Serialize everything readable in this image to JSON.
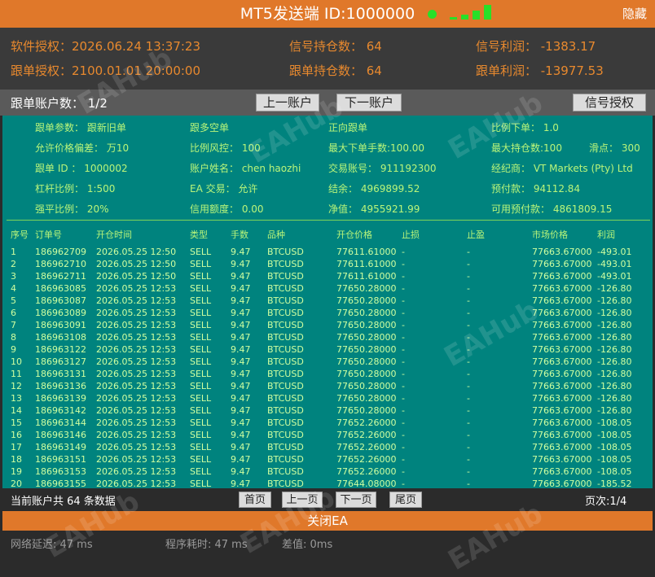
{
  "title": "MT5发送端  ID:1000000",
  "hide_label": "隐藏",
  "colors": {
    "accent": "#e0782a",
    "panel": "#00837e",
    "text_green": "#b9f57a",
    "status_led": "#28e028"
  },
  "info": {
    "software_auth": "软件授权：2026.06.24 13:37:23",
    "signal_positions": "信号持仓数：  64",
    "signal_profit": "信号利润：  -1383.17",
    "follow_auth": "跟单授权：2100.01.01 20:00:00",
    "follow_positions": "跟单持仓数：  64",
    "follow_profit": "跟单利润：  -13977.53"
  },
  "nav": {
    "account_count": "跟单账户数：  1/2",
    "prev": "上一账户",
    "next": "下一账户",
    "signal_auth": "信号授权"
  },
  "params": {
    "p1": "跟单参数：  跟新旧单",
    "p2": "跟多空单",
    "p3": "正向跟单",
    "p4": "比例下单：  1.0",
    "p5": "允许价格偏差：  万10",
    "p6": "比例风控：  100",
    "p7": "最大下单手数:100.00",
    "p8": "最大持仓数:100",
    "p9": "滑点：  300",
    "p10": "跟单   ID  ：  1000002",
    "p11": "账户姓名：  chen haozhi",
    "p12": "交易账号：  911192300",
    "p13": "经纪商：  VT Markets (Pty) Ltd",
    "p14": "杠杆比例：  1:500",
    "p15": "EA  交易：  允许",
    "p16": "结余：  4969899.52",
    "p17": "预付款：  94112.84",
    "p18": "强平比例：  20%",
    "p19": "信用额度：  0.00",
    "p20": "净值：  4955921.99",
    "p21": "可用预付款：  4861809.15"
  },
  "table": {
    "headers": [
      "序号",
      "订单号",
      "开仓时间",
      "类型",
      "手数",
      "品种",
      "开仓价格",
      "止损",
      "止盈",
      "市场价格",
      "利润"
    ],
    "rows": [
      [
        "1",
        "186962709",
        "2026.05.25 12:50",
        "SELL",
        "9.47",
        "BTCUSD",
        "77611.61000",
        "-",
        "-",
        "77663.67000",
        "-493.01"
      ],
      [
        "2",
        "186962710",
        "2026.05.25 12:50",
        "SELL",
        "9.47",
        "BTCUSD",
        "77611.61000",
        "-",
        "-",
        "77663.67000",
        "-493.01"
      ],
      [
        "3",
        "186962711",
        "2026.05.25 12:50",
        "SELL",
        "9.47",
        "BTCUSD",
        "77611.61000",
        "-",
        "-",
        "77663.67000",
        "-493.01"
      ],
      [
        "4",
        "186963085",
        "2026.05.25 12:53",
        "SELL",
        "9.47",
        "BTCUSD",
        "77650.28000",
        "-",
        "-",
        "77663.67000",
        "-126.80"
      ],
      [
        "5",
        "186963087",
        "2026.05.25 12:53",
        "SELL",
        "9.47",
        "BTCUSD",
        "77650.28000",
        "-",
        "-",
        "77663.67000",
        "-126.80"
      ],
      [
        "6",
        "186963089",
        "2026.05.25 12:53",
        "SELL",
        "9.47",
        "BTCUSD",
        "77650.28000",
        "-",
        "-",
        "77663.67000",
        "-126.80"
      ],
      [
        "7",
        "186963091",
        "2026.05.25 12:53",
        "SELL",
        "9.47",
        "BTCUSD",
        "77650.28000",
        "-",
        "-",
        "77663.67000",
        "-126.80"
      ],
      [
        "8",
        "186963108",
        "2026.05.25 12:53",
        "SELL",
        "9.47",
        "BTCUSD",
        "77650.28000",
        "-",
        "-",
        "77663.67000",
        "-126.80"
      ],
      [
        "9",
        "186963122",
        "2026.05.25 12:53",
        "SELL",
        "9.47",
        "BTCUSD",
        "77650.28000",
        "-",
        "-",
        "77663.67000",
        "-126.80"
      ],
      [
        "10",
        "186963127",
        "2026.05.25 12:53",
        "SELL",
        "9.47",
        "BTCUSD",
        "77650.28000",
        "-",
        "-",
        "77663.67000",
        "-126.80"
      ],
      [
        "11",
        "186963131",
        "2026.05.25 12:53",
        "SELL",
        "9.47",
        "BTCUSD",
        "77650.28000",
        "-",
        "-",
        "77663.67000",
        "-126.80"
      ],
      [
        "12",
        "186963136",
        "2026.05.25 12:53",
        "SELL",
        "9.47",
        "BTCUSD",
        "77650.28000",
        "-",
        "-",
        "77663.67000",
        "-126.80"
      ],
      [
        "13",
        "186963139",
        "2026.05.25 12:53",
        "SELL",
        "9.47",
        "BTCUSD",
        "77650.28000",
        "-",
        "-",
        "77663.67000",
        "-126.80"
      ],
      [
        "14",
        "186963142",
        "2026.05.25 12:53",
        "SELL",
        "9.47",
        "BTCUSD",
        "77650.28000",
        "-",
        "-",
        "77663.67000",
        "-126.80"
      ],
      [
        "15",
        "186963144",
        "2026.05.25 12:53",
        "SELL",
        "9.47",
        "BTCUSD",
        "77652.26000",
        "-",
        "-",
        "77663.67000",
        "-108.05"
      ],
      [
        "16",
        "186963146",
        "2026.05.25 12:53",
        "SELL",
        "9.47",
        "BTCUSD",
        "77652.26000",
        "-",
        "-",
        "77663.67000",
        "-108.05"
      ],
      [
        "17",
        "186963149",
        "2026.05.25 12:53",
        "SELL",
        "9.47",
        "BTCUSD",
        "77652.26000",
        "-",
        "-",
        "77663.67000",
        "-108.05"
      ],
      [
        "18",
        "186963151",
        "2026.05.25 12:53",
        "SELL",
        "9.47",
        "BTCUSD",
        "77652.26000",
        "-",
        "-",
        "77663.67000",
        "-108.05"
      ],
      [
        "19",
        "186963153",
        "2026.05.25 12:53",
        "SELL",
        "9.47",
        "BTCUSD",
        "77652.26000",
        "-",
        "-",
        "77663.67000",
        "-108.05"
      ],
      [
        "20",
        "186963155",
        "2026.05.25 12:53",
        "SELL",
        "9.47",
        "BTCUSD",
        "77644.08000",
        "-",
        "-",
        "77663.67000",
        "-185.52"
      ]
    ]
  },
  "footer": {
    "count_text": "当前账户共 64 条数据",
    "first": "首页",
    "prev": "上一页",
    "next": "下一页",
    "last": "尾页",
    "page": "页次:1/4",
    "close": "关闭EA"
  },
  "status": {
    "latency": "网络延迟:   47 ms",
    "program_time": "程序耗时:   47 ms",
    "diff": "差值:    0ms"
  },
  "watermark": "EAHub"
}
